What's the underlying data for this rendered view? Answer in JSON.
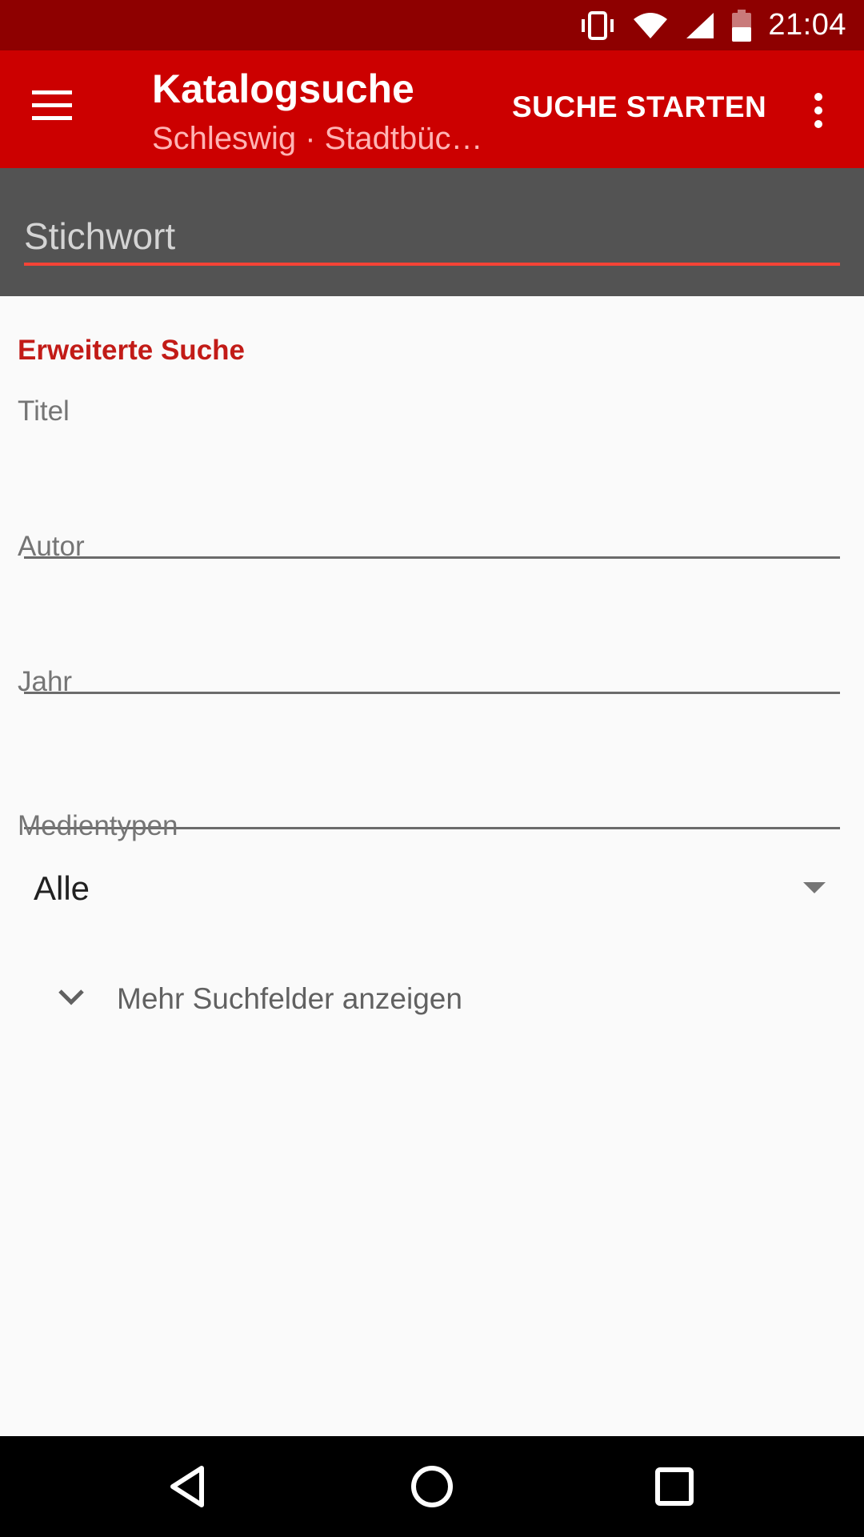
{
  "status_bar": {
    "time": "21:04",
    "icons": [
      "vibrate-icon",
      "wifi-icon",
      "signal-icon",
      "battery-icon"
    ]
  },
  "app_bar": {
    "title": "Katalogsuche",
    "subtitle": "Schleswig · Stadtbüc…",
    "action_label": "SUCHE STARTEN",
    "menu_icon": "hamburger-menu-icon",
    "overflow_icon": "more-vert-icon"
  },
  "search": {
    "placeholder": "Stichwort",
    "value": ""
  },
  "form": {
    "section_title": "Erweiterte Suche",
    "fields": [
      {
        "label": "Titel",
        "value": ""
      },
      {
        "label": "Autor",
        "value": ""
      },
      {
        "label": "Jahr",
        "value": ""
      }
    ],
    "media_types": {
      "label": "Medientypen",
      "selected": "Alle"
    },
    "more_fields_label": "Mehr Suchfelder anzeigen"
  },
  "nav_bar": {
    "icons": [
      "back-icon",
      "home-icon",
      "recents-icon"
    ]
  },
  "colors": {
    "status_bar": "#8E0000",
    "app_bar": "#CC0000",
    "search_bar": "#535353",
    "accent": "#C21B17",
    "search_underline": "#F44336"
  }
}
